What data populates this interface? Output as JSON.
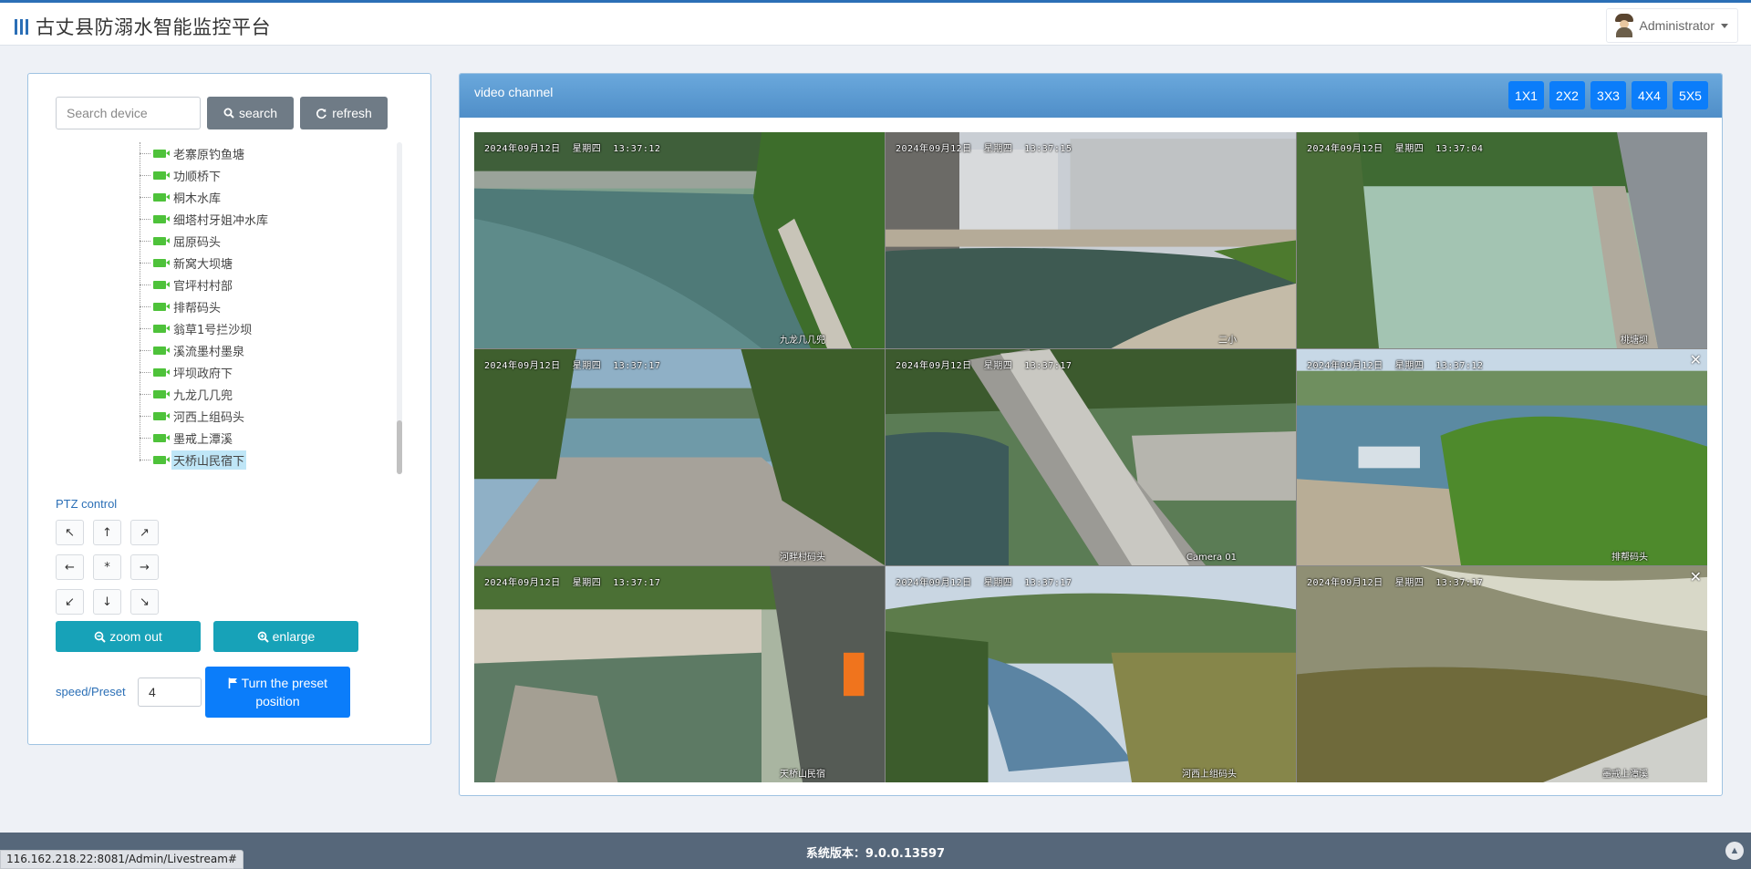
{
  "header": {
    "title": "古丈县防溺水智能监控平台",
    "user": "Administrator"
  },
  "left": {
    "search_placeholder": "Search device",
    "search_label": "search",
    "refresh_label": "refresh",
    "tree_items": [
      "老寨原钓鱼塘",
      "功顺桥下",
      "桐木水库",
      "细塔村牙姐冲水库",
      "屈原码头",
      "新窝大坝塘",
      "官坪村村部",
      "排帮码头",
      "翁草1号拦沙坝",
      "溪流墨村墨泉",
      "坪坝政府下",
      "九龙几几兜",
      "河西上组码头",
      "墨戒上潭溪",
      "天桥山民宿下"
    ],
    "ptz_label": "PTZ control",
    "ptz_buttons": [
      "↖",
      "↑",
      "↗",
      "←",
      "*",
      "→",
      "↙",
      "↓",
      "↘"
    ],
    "zoom_out_label": "zoom out",
    "enlarge_label": "enlarge",
    "speed_label": "speed/Preset",
    "speed_value": "4",
    "preset_label": "Turn the preset position"
  },
  "video": {
    "title": "video channel",
    "layouts": [
      "1X1",
      "2X2",
      "3X3",
      "4X4",
      "5X5"
    ],
    "cells": [
      {
        "timestamp": "2024年09月12日  星期四  13:37:12",
        "name": "九龙几几兜"
      },
      {
        "timestamp": "2024年09月12日  星期四  13:37:15",
        "name": "二小"
      },
      {
        "timestamp": "2024年09月12日  星期四  13:37:04",
        "name": "桃塘坝"
      },
      {
        "timestamp": "2024年09月12日  星期四  13:37:17",
        "name": "河畔村码头"
      },
      {
        "timestamp": "2024年09月12日  星期四  13:37:17",
        "name": "Camera 01"
      },
      {
        "timestamp": "2024年09月12日  星期四  13:37:12",
        "name": "排帮码头"
      },
      {
        "timestamp": "2024年09月12日  星期四  13:37:17",
        "name": "天桥山民宿"
      },
      {
        "timestamp": "2024年09月12日  星期四  13:37:17",
        "name": "河西上组码头"
      },
      {
        "timestamp": "2024年09月12日  星期四  13:37:17",
        "name": "墨戒上潭溪"
      }
    ]
  },
  "footer": {
    "version": "系统版本：9.0.0.13597",
    "url": "116.162.218.22:8081/Admin/Livestream#"
  }
}
